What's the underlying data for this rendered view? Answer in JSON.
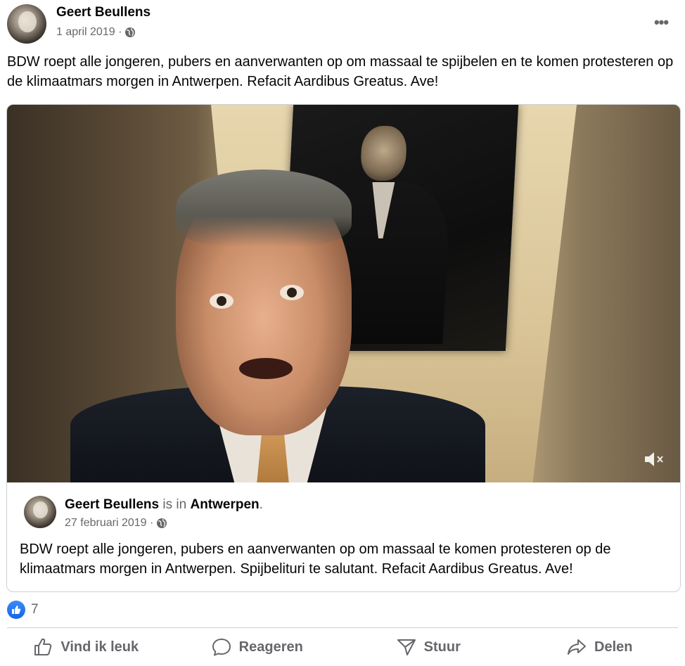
{
  "post": {
    "author": "Geert Beullens",
    "date": "1 april 2019 ·",
    "text": "BDW roept alle jongeren, pubers en aanverwanten op om massaal te spijbelen en te komen protesteren op de klimaatmars morgen in Antwerpen. Refacit Aardibus Greatus. Ave!",
    "more_label": "•••"
  },
  "shared": {
    "author": "Geert Beullens",
    "connector": " is in ",
    "location": "Antwerpen",
    "period": ".",
    "date": "27 februari 2019 ·",
    "text": "BDW roept alle jongeren, pubers en aanverwanten  op om massaal te komen protesteren op de klimaatmars morgen in Antwerpen. Spijbelituri te salutant. Refacit Aardibus Greatus. Ave!",
    "media_icon": "mute-icon"
  },
  "reactions": {
    "count": "7",
    "icon": "like-icon",
    "color": "#1877f2"
  },
  "actions": [
    {
      "label": "Vind ik leuk",
      "icon": "thumbs-up-icon"
    },
    {
      "label": "Reageren",
      "icon": "comment-icon"
    },
    {
      "label": "Stuur",
      "icon": "send-icon"
    },
    {
      "label": "Delen",
      "icon": "share-icon"
    }
  ]
}
